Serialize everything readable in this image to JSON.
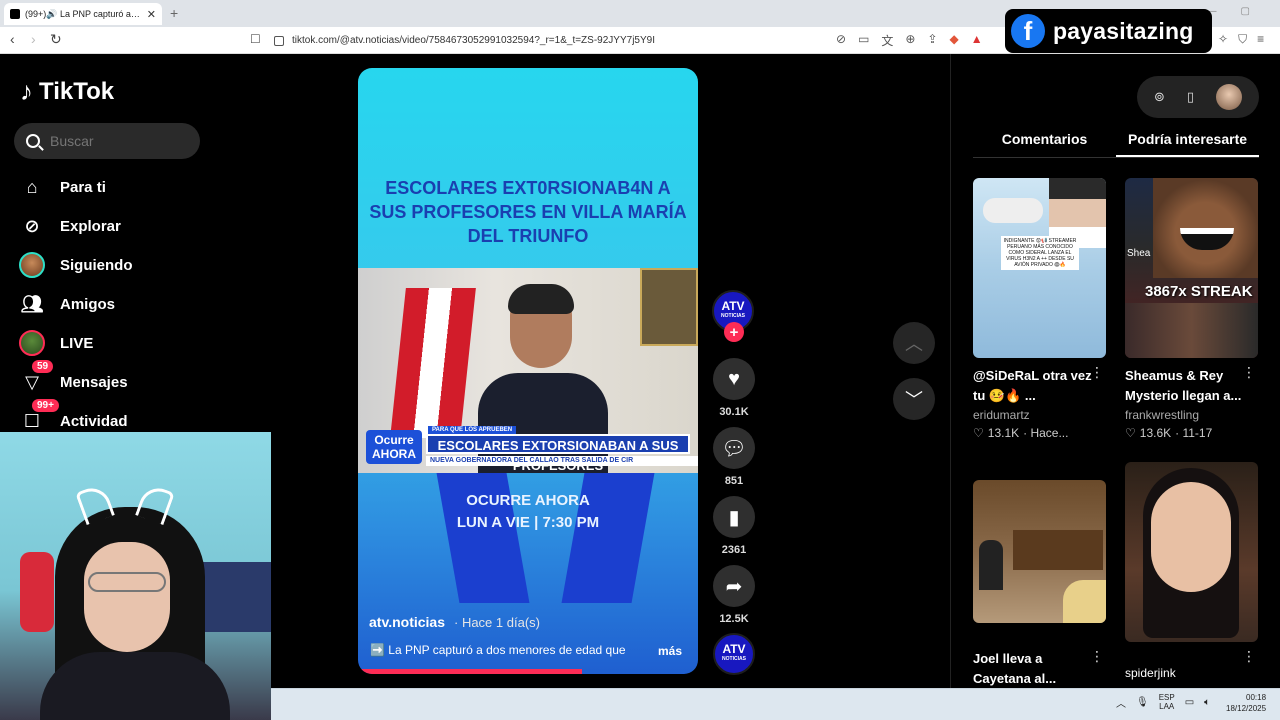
{
  "browser": {
    "tab_title": "(99+)🔊 La PNP capturó a do",
    "tab_close": "✕",
    "new_tab": "+",
    "url": "tiktok.com/@atv.noticias/video/7584673052991032594?_r=1&_t=ZS-92JYY7j5Y9I",
    "back_icon": "‹",
    "forward_icon": "›",
    "reload_icon": "↻"
  },
  "overlay_badge": {
    "icon": "f",
    "name": "payasitazing"
  },
  "sidebar": {
    "logo_text": "TikTok",
    "search_placeholder": "Buscar",
    "items": [
      {
        "label": "Para ti",
        "icon": "home-icon"
      },
      {
        "label": "Explorar",
        "icon": "compass-icon"
      },
      {
        "label": "Siguiendo",
        "icon": "avatar"
      },
      {
        "label": "Amigos",
        "icon": "friends-icon"
      },
      {
        "label": "LIVE",
        "icon": "live-avatar"
      },
      {
        "label": "Mensajes",
        "icon": "messages-icon",
        "badge": "59"
      },
      {
        "label": "Actividad",
        "icon": "activity-icon",
        "badge": "99+"
      }
    ]
  },
  "video": {
    "headline": "ESCOLARES EXT0RSIONAB4N A SUS PROFESORES EN VILLA MARÍA DEL TRIUNFO",
    "lower_third": {
      "brand_line1": "Ocurre",
      "brand_line2": "AHORA",
      "kicker": "PARA QUE LOS APRUEBEN",
      "main": "ESCOLARES EXTORSIONABAN A SUS PROFESORES",
      "sub": "NUEVA GOBERNADORA DEL CALLAO TRAS SALIDA DE CIR"
    },
    "show_name": "OCURRE AHORA",
    "show_schedule": "LUN A VIE | 7:30 PM",
    "author": "atv.noticias",
    "posted": "· Hace 1 día(s)",
    "caption": "➡️ La PNP capturó a dos menores de edad que",
    "more": "más",
    "progress": 0.66
  },
  "actions": {
    "channel_logo": "ATV",
    "channel_sub": "NOTICIAS",
    "follow": "+",
    "likes": "30.1K",
    "comments": "851",
    "saves": "2361",
    "shares": "12.5K"
  },
  "right_panel": {
    "tab_comments": "Comentarios",
    "tab_suggested": "Podría interesarte",
    "cards": [
      {
        "title": "@SiDeRaL otra vez tu 🤒🔥 ...",
        "author": "eridumartz",
        "likes": "13.1K",
        "date": "· Hace..."
      },
      {
        "title": "Sheamus & Rey Mysterio llegan a...",
        "author": "frankwrestling",
        "likes": "13.6K",
        "date": "· 11-17",
        "thumb_text": "3867x STREAK",
        "thumb_small": "Shea"
      },
      {
        "title": "Joel lleva a Cayetana al...",
        "author": "",
        "likes": "",
        "date": ""
      },
      {
        "title": "",
        "author": "spiderjink",
        "likes": "",
        "date": ""
      }
    ],
    "card1_overlay": "INDIGNANTE 😡📢 STREAMER PERUANO MÁS CONOCIDO COMO SIDERAL LANZA EL VIRUS H3N2 A ++ DESDE SU AVIÓN PRIVADO 😱🔥"
  },
  "taskbar": {
    "lang1": "ESP",
    "lang2": "LAA",
    "time": "00:18",
    "date": "18/12/2025"
  }
}
